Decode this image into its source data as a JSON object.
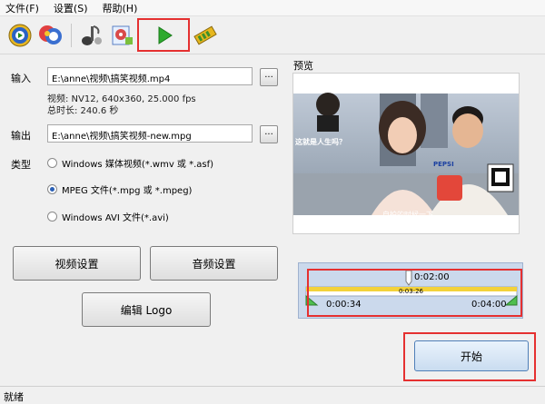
{
  "menubar": {
    "items": [
      "文件(F)",
      "设置(S)",
      "帮助(H)"
    ]
  },
  "toolbar": {
    "icons": [
      "video-convert-icon",
      "batch-convert-icon",
      "audio-convert-icon",
      "ripper-icon",
      "play-start-icon",
      "film-strip-icon"
    ]
  },
  "input": {
    "label": "输入",
    "path": "E:\\anne\\视频\\搞笑视频.mp4",
    "browse": "...",
    "video_info": "视频: NV12, 640x360, 25.000 fps",
    "duration_info": "总时长: 240.6 秒"
  },
  "output": {
    "label": "输出",
    "path": "E:\\anne\\视频\\搞笑视频-new.mpg",
    "browse": "..."
  },
  "type": {
    "label": "类型",
    "options": [
      {
        "label": "Windows 媒体视频(*.wmv 或 *.asf)",
        "checked": false
      },
      {
        "label": "MPEG 文件(*.mpg 或 *.mpeg)",
        "checked": true
      },
      {
        "label": "Windows AVI 文件(*.avi)",
        "checked": false
      }
    ]
  },
  "buttons": {
    "video_settings": "视频设置",
    "audio_settings": "音频设置",
    "edit_logo": "编辑 Logo",
    "start": "开始"
  },
  "preview": {
    "label": "预览",
    "overlay_text_top": "这就是人生吗？",
    "subtitle": "自拍的时候一下",
    "logo_text": "PEPSI"
  },
  "timeline": {
    "current_time": "0:02:00",
    "selection_length": "0:03:26",
    "start_time": "0:00:34",
    "end_time": "0:04:00"
  },
  "status": {
    "text": "就绪"
  },
  "colors": {
    "highlight": "#e53030",
    "play_green": "#2eaa2e",
    "timeline_bg": "#cbd9ec",
    "selection_yellow": "#f3d23a"
  }
}
